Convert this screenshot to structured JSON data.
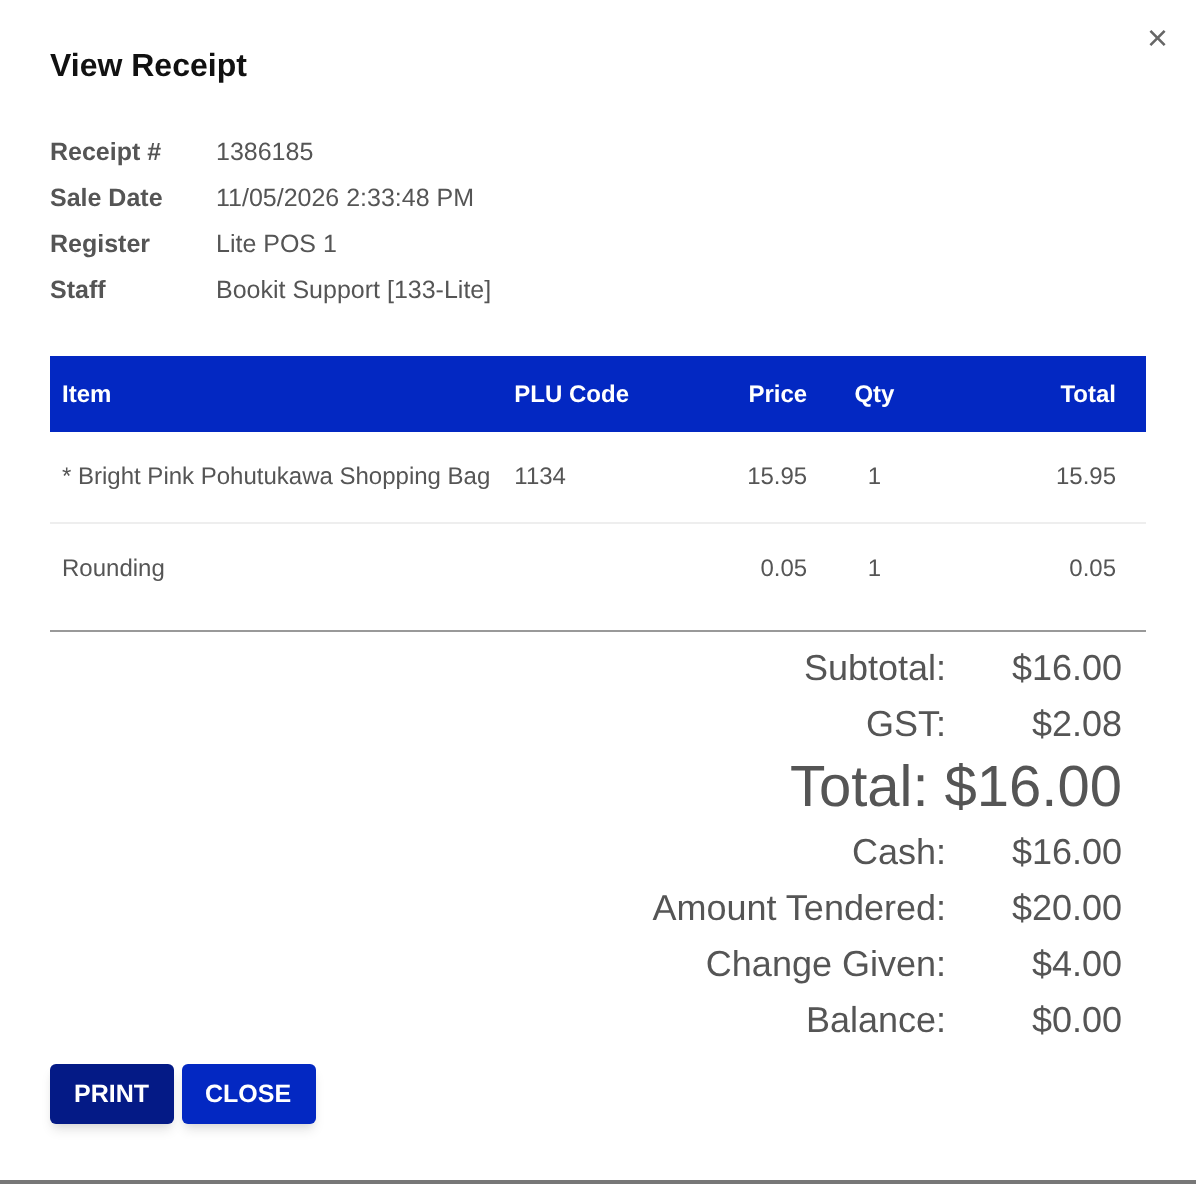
{
  "dialog": {
    "title": "View Receipt",
    "close_icon": "×"
  },
  "details": [
    {
      "label": "Receipt #",
      "value": "1386185"
    },
    {
      "label": "Sale Date",
      "value": "11/05/2026 2:33:48 PM"
    },
    {
      "label": "Register",
      "value": "Lite POS 1"
    },
    {
      "label": "Staff",
      "value": "Bookit Support [133-Lite]"
    }
  ],
  "table": {
    "columns": [
      "Item",
      "PLU Code",
      "Price",
      "Qty",
      "Total"
    ],
    "rows": [
      [
        "* Bright Pink Pohutukawa Shopping Bag",
        "1134",
        "15.95",
        "1",
        "15.95"
      ],
      [
        "Rounding",
        "",
        "0.05",
        "1",
        "0.05"
      ]
    ]
  },
  "totals": [
    {
      "kind": "line",
      "label": "Subtotal:",
      "value": "$16.00"
    },
    {
      "kind": "line",
      "label": "GST:",
      "value": "$2.08"
    },
    {
      "kind": "grand",
      "label": "Total:",
      "value": "$16.00"
    },
    {
      "kind": "line",
      "label": "Cash:",
      "value": "$16.00"
    },
    {
      "kind": "line",
      "label": "Amount Tendered:",
      "value": "$20.00"
    },
    {
      "kind": "line",
      "label": "Change Given:",
      "value": "$4.00"
    },
    {
      "kind": "line",
      "label": "Balance:",
      "value": "$0.00"
    }
  ],
  "buttons": [
    {
      "label": "PRINT",
      "focused": true
    },
    {
      "label": "CLOSE",
      "focused": false
    }
  ]
}
